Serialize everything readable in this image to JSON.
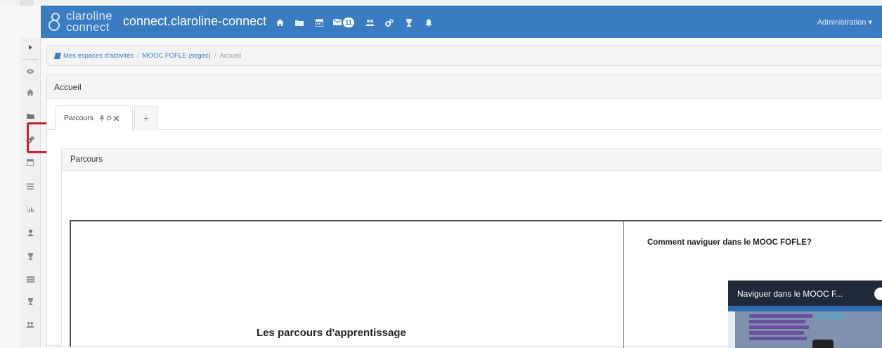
{
  "colors": {
    "navbar": "#3a7cc1",
    "link": "#3a7cc1",
    "highlight_box": "#c0262a"
  },
  "navbar": {
    "logo_line1": "claroline",
    "logo_line2": "connect",
    "site_title": "connect.claroline-connect",
    "icons": [
      "home-icon",
      "folder-icon",
      "calendar-icon",
      "envelope-icon",
      "users-icon",
      "cogs-icon",
      "trophy-icon",
      "bell-icon"
    ],
    "messages_badge": "11",
    "admin_label": "Administration ▾"
  },
  "sidebar": {
    "icons": [
      "caret-right-icon",
      "eye-icon",
      "home-icon",
      "folder-icon",
      "cogs-icon",
      "calendar-icon",
      "list-icon",
      "bar-chart-icon",
      "user-icon",
      "trophy-icon",
      "table-icon",
      "trophy-icon",
      "users-icon"
    ],
    "highlighted": "cogs-icon"
  },
  "breadcrumb": {
    "items": [
      "Mes espaces d'activités",
      "MOOC FOFLE (segec)",
      "Accueil"
    ]
  },
  "panel": {
    "title": "Accueil",
    "tab_label": "Parcours",
    "tab_add": "+"
  },
  "inner": {
    "title": "Parcours"
  },
  "content": {
    "heading": "Les parcours d'apprentissage",
    "howto": "Comment naviguer dans le MOOC FOFLE?",
    "video_title": "Naviguer dans le MOOC F..."
  }
}
